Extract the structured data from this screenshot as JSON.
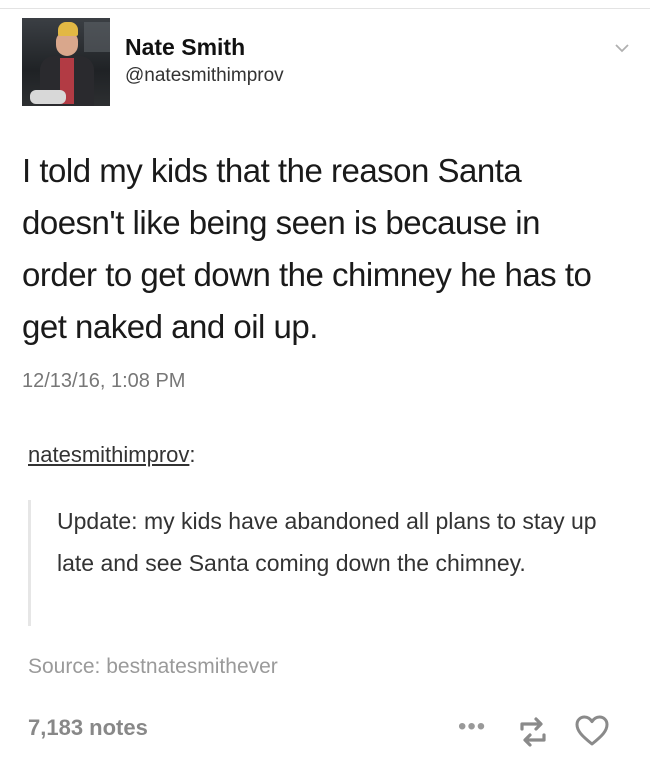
{
  "post": {
    "author_name": "Nate Smith",
    "author_handle": "@natesmithimprov",
    "text": "I told my kids that the reason Santa doesn't like being seen is because in order to get down the chimney he has to get naked and oil up.",
    "timestamp": "12/13/16, 1:08 PM"
  },
  "reblog": {
    "username": "natesmithimprov",
    "suffix": ":",
    "quote": "Update: my kids have abandoned all plans to stay up late and see Santa coming down the chimney."
  },
  "source": "Source: bestnatesmithever",
  "footer": {
    "notes": "7,183 notes",
    "more": "•••"
  },
  "icons": {
    "chevron": "chevron-down-icon",
    "reblog": "reblog-icon",
    "like": "heart-icon"
  },
  "colors": {
    "icon_gray": "#8a8a8a",
    "muted_text": "#9a9a9a"
  }
}
